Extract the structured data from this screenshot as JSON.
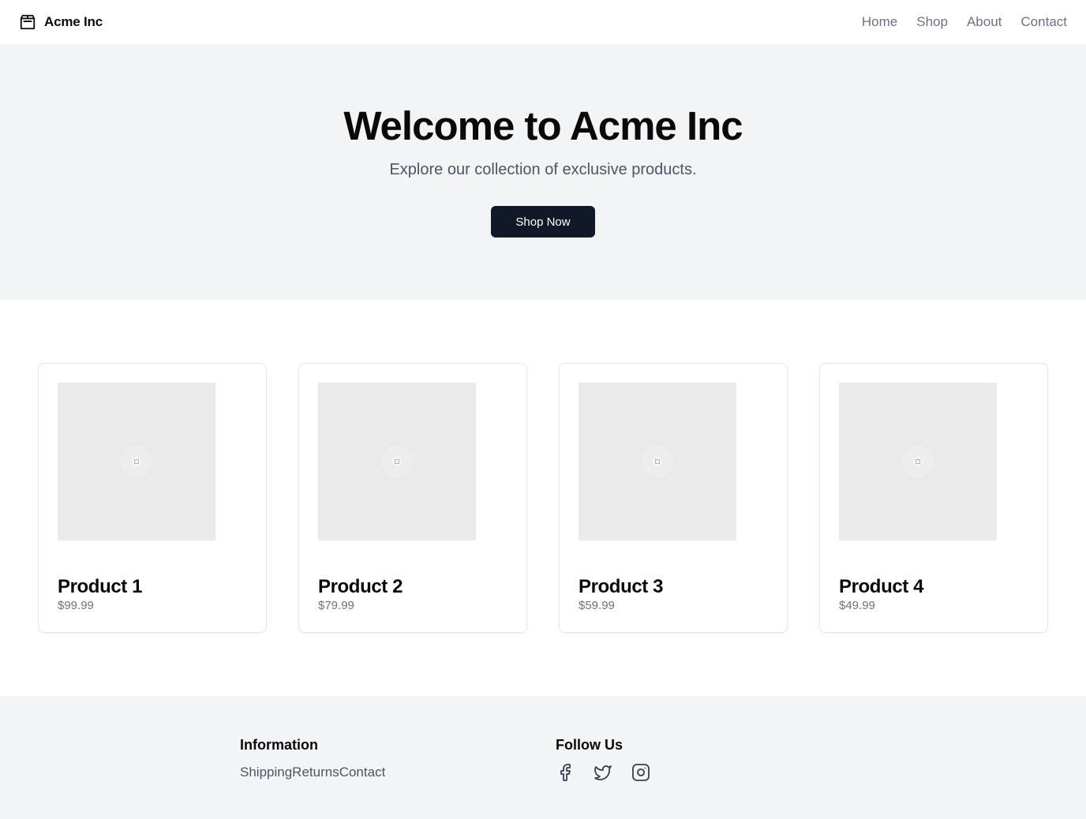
{
  "header": {
    "brand": "Acme Inc",
    "brand_icon": "package-icon",
    "nav": [
      "Home",
      "Shop",
      "About",
      "Contact"
    ]
  },
  "hero": {
    "title": "Welcome to Acme Inc",
    "subtitle": "Explore our collection of exclusive products.",
    "cta_label": "Shop Now"
  },
  "products": [
    {
      "name": "Product 1",
      "price": "$99.99"
    },
    {
      "name": "Product 2",
      "price": "$79.99"
    },
    {
      "name": "Product 3",
      "price": "$59.99"
    },
    {
      "name": "Product 4",
      "price": "$49.99"
    }
  ],
  "footer": {
    "information_title": "Information",
    "links": [
      "Shipping",
      "Returns",
      "Contact"
    ],
    "follow_title": "Follow Us",
    "social_icons": [
      "facebook-icon",
      "twitter-icon",
      "instagram-icon"
    ]
  },
  "colors": {
    "accent": "#111827",
    "muted_bg": "#f3f4f6",
    "muted_text": "#6b7280"
  }
}
